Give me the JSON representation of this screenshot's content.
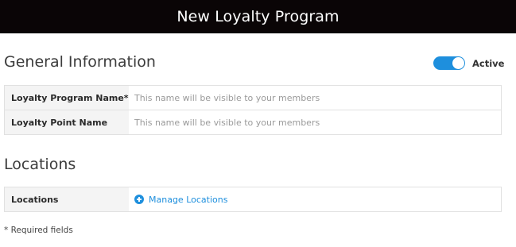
{
  "header": {
    "title": "New Loyalty Program"
  },
  "general": {
    "title": "General Information",
    "active_label": "Active",
    "active_on": true,
    "accent_color": "#1e8fdd",
    "fields": [
      {
        "label": "Loyalty Program Name*",
        "value": "",
        "placeholder": "This name will be visible to your members"
      },
      {
        "label": "Loyalty Point Name",
        "value": "",
        "placeholder": "This name will be visible to your members"
      }
    ]
  },
  "locations": {
    "title": "Locations",
    "row_label": "Locations",
    "manage_label": "Manage Locations",
    "manage_icon": "plus-circle-icon"
  },
  "footer": {
    "required_note": "* Required fields"
  }
}
